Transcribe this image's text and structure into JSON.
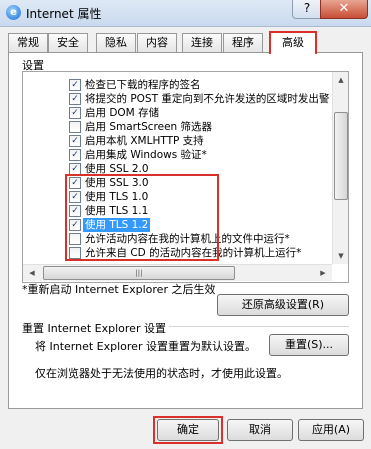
{
  "window": {
    "title": "Internet 属性",
    "icon": "ie-icon",
    "help_label": "?",
    "close_label": "✕"
  },
  "tabs": [
    {
      "label": "常规"
    },
    {
      "label": "安全"
    },
    {
      "label": "隐私"
    },
    {
      "label": "内容"
    },
    {
      "label": "连接"
    },
    {
      "label": "程序"
    },
    {
      "label": "高级",
      "active": true
    }
  ],
  "settings": {
    "label": "设置",
    "items": [
      {
        "label": "检查已下载的程序的签名",
        "checked": true
      },
      {
        "label": "将提交的 POST 重定向到不允许发送的区域时发出警",
        "checked": true
      },
      {
        "label": "启用 DOM 存储",
        "checked": true
      },
      {
        "label": "启用 SmartScreen 筛选器",
        "checked": false
      },
      {
        "label": "启用本机 XMLHTTP 支持",
        "checked": true
      },
      {
        "label": "启用集成 Windows 验证*",
        "checked": true
      },
      {
        "label": "使用 SSL 2.0",
        "checked": true
      },
      {
        "label": "使用 SSL 3.0",
        "checked": true
      },
      {
        "label": "使用 TLS 1.0",
        "checked": true
      },
      {
        "label": "使用 TLS 1.1",
        "checked": true
      },
      {
        "label": "使用 TLS 1.2",
        "checked": true,
        "selected": true
      },
      {
        "label": "允许活动内容在我的计算机上的文件中运行*",
        "checked": false
      },
      {
        "label": "允许来自 CD 的活动内容在我的计算机上运行*",
        "checked": false
      }
    ],
    "check_glyph": "✓",
    "scroll_up": "▲",
    "scroll_down": "▼",
    "scroll_left": "◀",
    "scroll_right": "▶",
    "grip": "|||"
  },
  "restart_note": "*重新启动 Internet Explorer 之后生效",
  "restore_button": "还原高级设置(R)",
  "reset": {
    "group_title": "重置 Internet Explorer 设置",
    "description": "将 Internet Explorer 设置重置为默认设置。",
    "button": "重置(S)...",
    "footnote": "仅在浏览器处于无法使用的状态时，才使用此设置。"
  },
  "footer": {
    "ok": "确定",
    "cancel": "取消",
    "apply": "应用(A)"
  },
  "colors": {
    "highlight": "#d9302a",
    "selection": "#3399ff"
  }
}
